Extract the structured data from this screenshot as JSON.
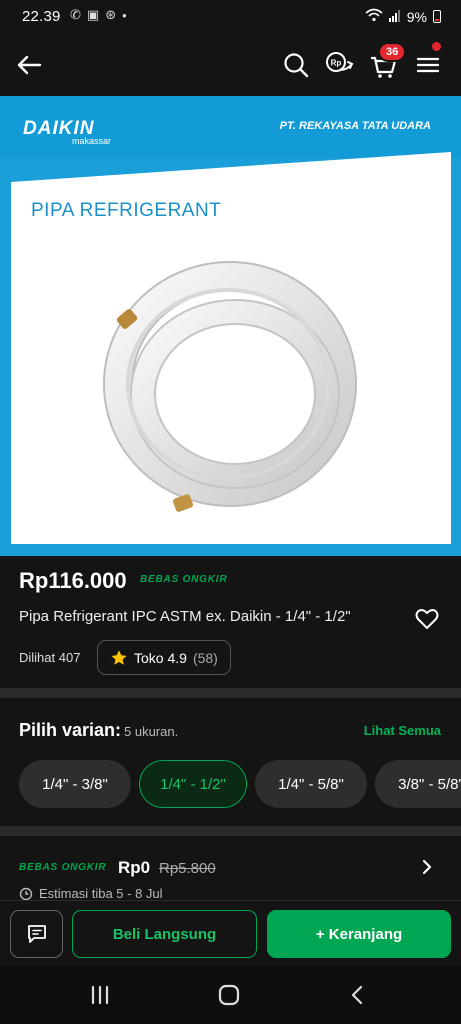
{
  "status_bar": {
    "time": "22.39",
    "battery": "9%"
  },
  "header": {
    "cart_count": "36"
  },
  "hero": {
    "brand": "DAIKIN",
    "brand_sub": "makassar",
    "company": "PT. REKAYASA TATA UDARA",
    "image_title": "PIPA REFRIGERANT"
  },
  "product": {
    "price": "Rp116.000",
    "free_shipping_label": "BEBAS ONGKIR",
    "name": "Pipa Refrigerant IPC ASTM ex. Daikin - 1/4\" - 1/2\"",
    "views": "Dilihat 407",
    "shop_rating": "Toko 4.9",
    "rating_count": "(58)"
  },
  "variants": {
    "title": "Pilih varian:",
    "count": "5 ukuran.",
    "see_all": "Lihat Semua",
    "options": [
      "1/4\" - 3/8\"",
      "1/4\" - 1/2\"",
      "1/4\" - 5/8\"",
      "3/8\" - 5/8\""
    ],
    "selected_index": 1
  },
  "shipping": {
    "label": "BEBAS ONGKIR",
    "price": "Rp0",
    "original_price": "Rp5.800",
    "estimate": "Estimasi tiba 5 - 8 Jul"
  },
  "actions": {
    "buy_now": "Beli Langsung",
    "add_to_cart": "+ Keranjang"
  },
  "colors": {
    "accent": "#00a651",
    "badge": "#e4262f",
    "brand_blue": "#1a9fd8"
  }
}
